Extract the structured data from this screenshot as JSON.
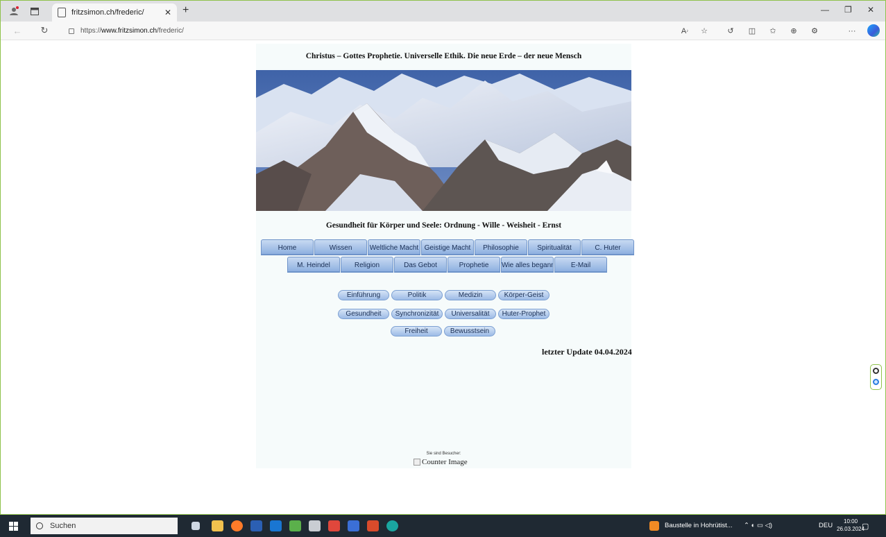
{
  "browser": {
    "tab_title": "fritzsimon.ch/frederic/",
    "url_scheme": "https://",
    "url_host": "www.fritzsimon.ch",
    "url_path": "/frederic/"
  },
  "page": {
    "title": "Christus – Gottes Prophetie. Universelle Ethik. Die neue Erde – der neue Mensch",
    "subtitle": "Gesundheit für Körper und Seele: Ordnung - Wille - Weisheit - Ernst",
    "menu_row1": [
      "Home",
      "Wissen",
      "Weltliche Macht",
      "Geistige Macht",
      "Philosophie",
      "Spiritualität",
      "C. Huter"
    ],
    "menu_row2": [
      "M. Heindel",
      "Religion",
      "Das Gebot",
      "Prophetie",
      "Wie alles begann",
      "E-Mail"
    ],
    "pills_row1": [
      "Einführung",
      "Politik",
      "Medizin",
      "Körper-Geist"
    ],
    "pills_row2": [
      "Gesundheit",
      "Synchronizität",
      "Universalität",
      "Huter-Prophet"
    ],
    "pills_row3": [
      "Freiheit",
      "Bewusstsein"
    ],
    "update": "letzter Update 04.04.2024",
    "visitors_label": "Sie sind Besucher:",
    "counter_alt": "Counter Image"
  },
  "taskbar": {
    "search": "Suchen",
    "notification": "Baustelle in Hohrütist...",
    "language": "DEU",
    "time": "10:00",
    "date": "26.03.2024"
  }
}
